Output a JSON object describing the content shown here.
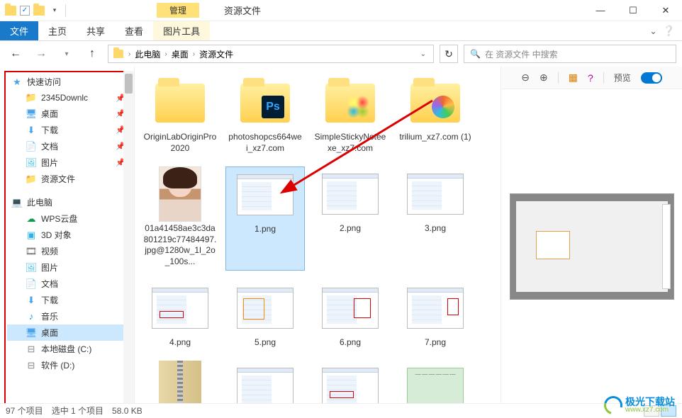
{
  "window": {
    "title": "资源文件",
    "ribbon_context": "管理",
    "min": "—",
    "max": "☐",
    "close": "✕"
  },
  "ribbon": {
    "file": "文件",
    "home": "主页",
    "share": "共享",
    "view": "查看",
    "pictools": "图片工具"
  },
  "address": {
    "back_icon": "←",
    "fwd_icon": "→",
    "up_icon": "↑",
    "seg1": "此电脑",
    "seg2": "桌面",
    "seg3": "资源文件",
    "refresh_icon": "↻"
  },
  "search": {
    "icon": "🔍",
    "placeholder": "在 资源文件 中搜索"
  },
  "sidebar": {
    "quick": "快速访问",
    "items": [
      {
        "label": "2345Downlc",
        "pin": true
      },
      {
        "label": "桌面",
        "pin": true
      },
      {
        "label": "下载",
        "pin": true
      },
      {
        "label": "文档",
        "pin": true
      },
      {
        "label": "图片",
        "pin": true
      },
      {
        "label": "资源文件",
        "pin": false
      }
    ],
    "pc": "此电脑",
    "pcitems": [
      {
        "label": "WPS云盘"
      },
      {
        "label": "3D 对象"
      },
      {
        "label": "视频"
      },
      {
        "label": "图片"
      },
      {
        "label": "文档"
      },
      {
        "label": "下载"
      },
      {
        "label": "音乐"
      },
      {
        "label": "桌面"
      },
      {
        "label": "本地磁盘 (C:)"
      },
      {
        "label": "软件 (D:)"
      }
    ]
  },
  "files": [
    {
      "name": "OriginLabOriginPro2020",
      "type": "folder"
    },
    {
      "name": "photoshopcs664wei_xz7.com",
      "type": "folder",
      "overlay": "ps"
    },
    {
      "name": "SimpleStickyNoteexe_xz7.com",
      "type": "folder",
      "overlay": "sp1"
    },
    {
      "name": "trilium_xz7.com (1)",
      "type": "folder",
      "overlay": "sp2"
    },
    {
      "name": "01a41458ae3c3da801219c77484497.jpg@1280w_1l_2o_100s...",
      "type": "portrait"
    },
    {
      "name": "1.png",
      "type": "screenshot",
      "selected": true
    },
    {
      "name": "2.png",
      "type": "screenshot"
    },
    {
      "name": "3.png",
      "type": "screenshot"
    },
    {
      "name": "4.png",
      "type": "screenshot",
      "hl": "red"
    },
    {
      "name": "5.png",
      "type": "screenshot",
      "hl": "orange"
    },
    {
      "name": "6.png",
      "type": "screenshot",
      "hl": "red2"
    },
    {
      "name": "7.png",
      "type": "screenshot",
      "hl": "red3"
    },
    {
      "name": "",
      "type": "zipper"
    },
    {
      "name": "",
      "type": "screenshot"
    },
    {
      "name": "",
      "type": "screenshot",
      "hl": "red"
    },
    {
      "name": "",
      "type": "greendoc"
    }
  ],
  "preview": {
    "zoom_out": "⊖",
    "zoom_in": "⊕",
    "grid_icon": "▦",
    "help_icon": "?",
    "label": "预览"
  },
  "status": {
    "count": "97 个项目",
    "selection": "选中 1 个项目",
    "size": "58.0 KB"
  },
  "watermark": {
    "zh": "极光下载站",
    "url": "www.xz7.com"
  }
}
